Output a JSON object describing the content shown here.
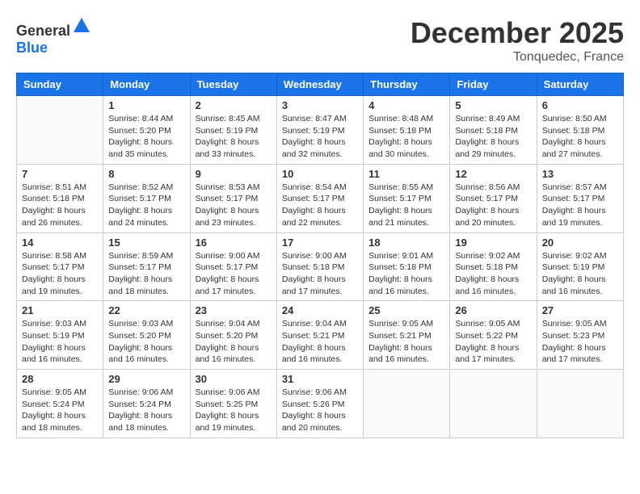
{
  "logo": {
    "general": "General",
    "blue": "Blue"
  },
  "title": {
    "month": "December 2025",
    "location": "Tonquedec, France"
  },
  "headers": [
    "Sunday",
    "Monday",
    "Tuesday",
    "Wednesday",
    "Thursday",
    "Friday",
    "Saturday"
  ],
  "weeks": [
    [
      {
        "day": "",
        "info": ""
      },
      {
        "day": "1",
        "info": "Sunrise: 8:44 AM\nSunset: 5:20 PM\nDaylight: 8 hours\nand 35 minutes."
      },
      {
        "day": "2",
        "info": "Sunrise: 8:45 AM\nSunset: 5:19 PM\nDaylight: 8 hours\nand 33 minutes."
      },
      {
        "day": "3",
        "info": "Sunrise: 8:47 AM\nSunset: 5:19 PM\nDaylight: 8 hours\nand 32 minutes."
      },
      {
        "day": "4",
        "info": "Sunrise: 8:48 AM\nSunset: 5:18 PM\nDaylight: 8 hours\nand 30 minutes."
      },
      {
        "day": "5",
        "info": "Sunrise: 8:49 AM\nSunset: 5:18 PM\nDaylight: 8 hours\nand 29 minutes."
      },
      {
        "day": "6",
        "info": "Sunrise: 8:50 AM\nSunset: 5:18 PM\nDaylight: 8 hours\nand 27 minutes."
      }
    ],
    [
      {
        "day": "7",
        "info": "Sunrise: 8:51 AM\nSunset: 5:18 PM\nDaylight: 8 hours\nand 26 minutes."
      },
      {
        "day": "8",
        "info": "Sunrise: 8:52 AM\nSunset: 5:17 PM\nDaylight: 8 hours\nand 24 minutes."
      },
      {
        "day": "9",
        "info": "Sunrise: 8:53 AM\nSunset: 5:17 PM\nDaylight: 8 hours\nand 23 minutes."
      },
      {
        "day": "10",
        "info": "Sunrise: 8:54 AM\nSunset: 5:17 PM\nDaylight: 8 hours\nand 22 minutes."
      },
      {
        "day": "11",
        "info": "Sunrise: 8:55 AM\nSunset: 5:17 PM\nDaylight: 8 hours\nand 21 minutes."
      },
      {
        "day": "12",
        "info": "Sunrise: 8:56 AM\nSunset: 5:17 PM\nDaylight: 8 hours\nand 20 minutes."
      },
      {
        "day": "13",
        "info": "Sunrise: 8:57 AM\nSunset: 5:17 PM\nDaylight: 8 hours\nand 19 minutes."
      }
    ],
    [
      {
        "day": "14",
        "info": "Sunrise: 8:58 AM\nSunset: 5:17 PM\nDaylight: 8 hours\nand 19 minutes."
      },
      {
        "day": "15",
        "info": "Sunrise: 8:59 AM\nSunset: 5:17 PM\nDaylight: 8 hours\nand 18 minutes."
      },
      {
        "day": "16",
        "info": "Sunrise: 9:00 AM\nSunset: 5:17 PM\nDaylight: 8 hours\nand 17 minutes."
      },
      {
        "day": "17",
        "info": "Sunrise: 9:00 AM\nSunset: 5:18 PM\nDaylight: 8 hours\nand 17 minutes."
      },
      {
        "day": "18",
        "info": "Sunrise: 9:01 AM\nSunset: 5:18 PM\nDaylight: 8 hours\nand 16 minutes."
      },
      {
        "day": "19",
        "info": "Sunrise: 9:02 AM\nSunset: 5:18 PM\nDaylight: 8 hours\nand 16 minutes."
      },
      {
        "day": "20",
        "info": "Sunrise: 9:02 AM\nSunset: 5:19 PM\nDaylight: 8 hours\nand 16 minutes."
      }
    ],
    [
      {
        "day": "21",
        "info": "Sunrise: 9:03 AM\nSunset: 5:19 PM\nDaylight: 8 hours\nand 16 minutes."
      },
      {
        "day": "22",
        "info": "Sunrise: 9:03 AM\nSunset: 5:20 PM\nDaylight: 8 hours\nand 16 minutes."
      },
      {
        "day": "23",
        "info": "Sunrise: 9:04 AM\nSunset: 5:20 PM\nDaylight: 8 hours\nand 16 minutes."
      },
      {
        "day": "24",
        "info": "Sunrise: 9:04 AM\nSunset: 5:21 PM\nDaylight: 8 hours\nand 16 minutes."
      },
      {
        "day": "25",
        "info": "Sunrise: 9:05 AM\nSunset: 5:21 PM\nDaylight: 8 hours\nand 16 minutes."
      },
      {
        "day": "26",
        "info": "Sunrise: 9:05 AM\nSunset: 5:22 PM\nDaylight: 8 hours\nand 17 minutes."
      },
      {
        "day": "27",
        "info": "Sunrise: 9:05 AM\nSunset: 5:23 PM\nDaylight: 8 hours\nand 17 minutes."
      }
    ],
    [
      {
        "day": "28",
        "info": "Sunrise: 9:05 AM\nSunset: 5:24 PM\nDaylight: 8 hours\nand 18 minutes."
      },
      {
        "day": "29",
        "info": "Sunrise: 9:06 AM\nSunset: 5:24 PM\nDaylight: 8 hours\nand 18 minutes."
      },
      {
        "day": "30",
        "info": "Sunrise: 9:06 AM\nSunset: 5:25 PM\nDaylight: 8 hours\nand 19 minutes."
      },
      {
        "day": "31",
        "info": "Sunrise: 9:06 AM\nSunset: 5:26 PM\nDaylight: 8 hours\nand 20 minutes."
      },
      {
        "day": "",
        "info": ""
      },
      {
        "day": "",
        "info": ""
      },
      {
        "day": "",
        "info": ""
      }
    ]
  ]
}
